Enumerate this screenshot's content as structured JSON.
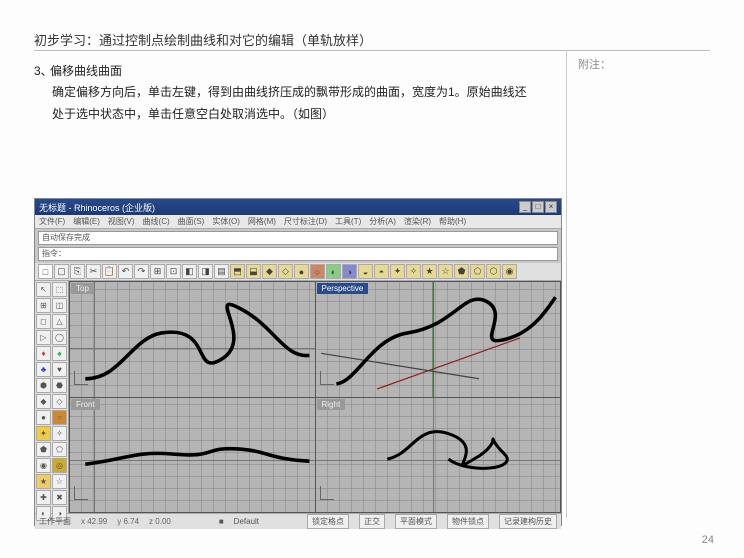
{
  "page": {
    "title": "初步学习：通过控制点绘制曲线和对它的编辑（单轨放样）",
    "section_number": "3、",
    "section_title": "偏移曲线曲面",
    "body": "确定偏移方向后，单击左键，得到由曲线挤压成的飘带形成的曲面，宽度为1。原始曲线还处于选中状态中，单击任意空白处取消选中。（如图）",
    "annotate_label": "附注：",
    "page_number": "24"
  },
  "app": {
    "window_title": "无标题 - Rhinoceros (企业版)",
    "menu_items": [
      "文件(F)",
      "编辑(E)",
      "视图(V)",
      "曲线(C)",
      "曲面(S)",
      "实体(O)",
      "网格(M)",
      "尺寸标注(D)",
      "工具(T)",
      "分析(A)",
      "渲染(R)",
      "帮助(H)"
    ],
    "cmd1": "自动保存完成",
    "cmd2": "指令：",
    "toolbar_icons": [
      "□",
      "▢",
      "⎘",
      "✂",
      "📋",
      "↶",
      "↷",
      "⊞",
      "⊡",
      "◧",
      "◨",
      "▤",
      "⬒",
      "⬓",
      "◆",
      "◇",
      "●",
      "○",
      "◐",
      "◑",
      "◒",
      "◓",
      "✦",
      "✧",
      "★",
      "☆",
      "⬟",
      "⬠",
      "⬡",
      "◉"
    ],
    "sidebar_icons": [
      "↖",
      "⬚",
      "⊞",
      "◫",
      "◻",
      "△",
      "▷",
      "◯",
      "♦",
      "♠",
      "♣",
      "♥",
      "⬢",
      "⬣",
      "◆",
      "◇",
      "●",
      "○",
      "✦",
      "✧",
      "⬟",
      "⬠",
      "◉",
      "◎",
      "★",
      "☆",
      "✚",
      "✖",
      "◐",
      "◑"
    ],
    "viewports": {
      "top": "Top",
      "persp": "Perspective",
      "front": "Front",
      "right": "Right"
    },
    "status": {
      "plane": "工作平面",
      "x": "x 42.99",
      "y": "y 6.74",
      "z": "z 0.00",
      "layer": "Default",
      "btns": [
        "锁定格点",
        "正交",
        "平面模式",
        "物件锁点",
        "记录建构历史"
      ]
    }
  }
}
